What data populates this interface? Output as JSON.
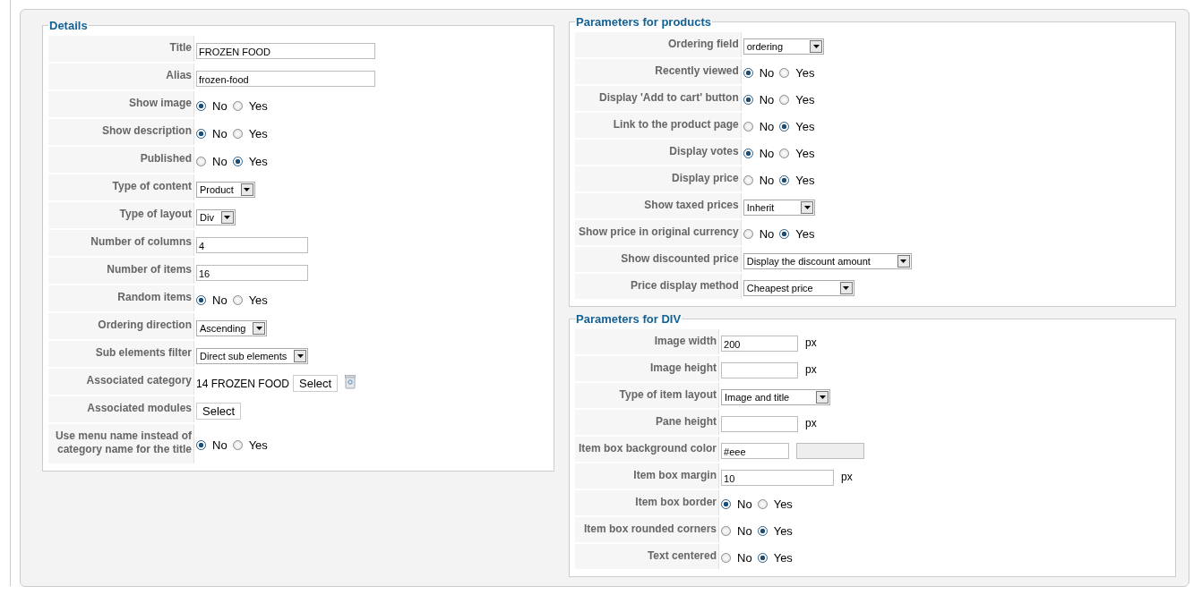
{
  "columns": [
    {
      "sections": [
        {
          "legend": "Details",
          "rows": [
            {
              "label": "Title",
              "kind": "text",
              "value": "FROZEN FOOD"
            },
            {
              "label": "Alias",
              "kind": "text",
              "value": "frozen-food"
            },
            {
              "label": "Show image",
              "kind": "radio",
              "options": [
                {
                  "label": "No",
                  "selected": true
                },
                {
                  "label": "Yes",
                  "selected": false
                }
              ]
            },
            {
              "label": "Show description",
              "kind": "radio",
              "options": [
                {
                  "label": "No",
                  "selected": true
                },
                {
                  "label": "Yes",
                  "selected": false
                }
              ]
            },
            {
              "label": "Published",
              "kind": "radio",
              "options": [
                {
                  "label": "No",
                  "selected": false
                },
                {
                  "label": "Yes",
                  "selected": true
                }
              ]
            },
            {
              "label": "Type of content",
              "kind": "select",
              "value": "Product"
            },
            {
              "label": "Type of layout",
              "kind": "select",
              "value": "Div"
            },
            {
              "label": "Number of columns",
              "kind": "number",
              "value": "4"
            },
            {
              "label": "Number of items",
              "kind": "number",
              "value": "16"
            },
            {
              "label": "Random items",
              "kind": "radio",
              "options": [
                {
                  "label": "No",
                  "selected": true
                },
                {
                  "label": "Yes",
                  "selected": false
                }
              ]
            },
            {
              "label": "Ordering direction",
              "kind": "select",
              "value": "Ascending"
            },
            {
              "label": "Sub elements filter",
              "kind": "select",
              "value": "Direct sub elements"
            },
            {
              "label": "Associated category",
              "kind": "category",
              "value": "14 FROZEN FOOD",
              "button": "Select"
            },
            {
              "label": "Associated modules",
              "kind": "button",
              "button": "Select"
            },
            {
              "label": "Use menu name instead of category name for the title",
              "kind": "radio",
              "options": [
                {
                  "label": "No",
                  "selected": true
                },
                {
                  "label": "Yes",
                  "selected": false
                }
              ]
            }
          ]
        }
      ]
    },
    {
      "sections": [
        {
          "legend": "Parameters for products",
          "rows": [
            {
              "label": "Ordering field",
              "kind": "select",
              "value": "ordering"
            },
            {
              "label": "Recently viewed",
              "kind": "radio",
              "options": [
                {
                  "label": "No",
                  "selected": true
                },
                {
                  "label": "Yes",
                  "selected": false
                }
              ]
            },
            {
              "label": "Display 'Add to cart' button",
              "kind": "radio",
              "options": [
                {
                  "label": "No",
                  "selected": true
                },
                {
                  "label": "Yes",
                  "selected": false
                }
              ]
            },
            {
              "label": "Link to the product page",
              "kind": "radio",
              "options": [
                {
                  "label": "No",
                  "selected": false
                },
                {
                  "label": "Yes",
                  "selected": true
                }
              ]
            },
            {
              "label": "Display votes",
              "kind": "radio",
              "options": [
                {
                  "label": "No",
                  "selected": true
                },
                {
                  "label": "Yes",
                  "selected": false
                }
              ]
            },
            {
              "label": "Display price",
              "kind": "radio",
              "options": [
                {
                  "label": "No",
                  "selected": false
                },
                {
                  "label": "Yes",
                  "selected": true
                }
              ]
            },
            {
              "label": "Show taxed prices",
              "kind": "select",
              "value": "Inherit"
            },
            {
              "label": "Show price in original currency",
              "kind": "radio",
              "options": [
                {
                  "label": "No",
                  "selected": false
                },
                {
                  "label": "Yes",
                  "selected": true
                }
              ]
            },
            {
              "label": "Show discounted price",
              "kind": "select",
              "value": "Display the discount amount"
            },
            {
              "label": "Price display method",
              "kind": "select",
              "value": "Cheapest price"
            }
          ]
        },
        {
          "legend": "Parameters for DIV",
          "rows": [
            {
              "label": "Image width",
              "kind": "number",
              "value": "200",
              "unit": "px"
            },
            {
              "label": "Image height",
              "kind": "number",
              "unit": "px"
            },
            {
              "label": "Type of item layout",
              "kind": "select",
              "value": "Image and title"
            },
            {
              "label": "Pane height",
              "kind": "number",
              "unit": "px"
            },
            {
              "label": "Item box background color",
              "kind": "color",
              "value": "#eee",
              "color": "#eeeeee"
            },
            {
              "label": "Item box margin",
              "kind": "text",
              "value": "10",
              "unit": "px"
            },
            {
              "label": "Item box border",
              "kind": "radio",
              "options": [
                {
                  "label": "No",
                  "selected": true
                },
                {
                  "label": "Yes",
                  "selected": false
                }
              ]
            },
            {
              "label": "Item box rounded corners",
              "kind": "radio",
              "options": [
                {
                  "label": "No",
                  "selected": false
                },
                {
                  "label": "Yes",
                  "selected": true
                }
              ]
            },
            {
              "label": "Text centered",
              "kind": "radio",
              "options": [
                {
                  "label": "No",
                  "selected": false
                },
                {
                  "label": "Yes",
                  "selected": true
                }
              ]
            }
          ]
        }
      ]
    }
  ]
}
